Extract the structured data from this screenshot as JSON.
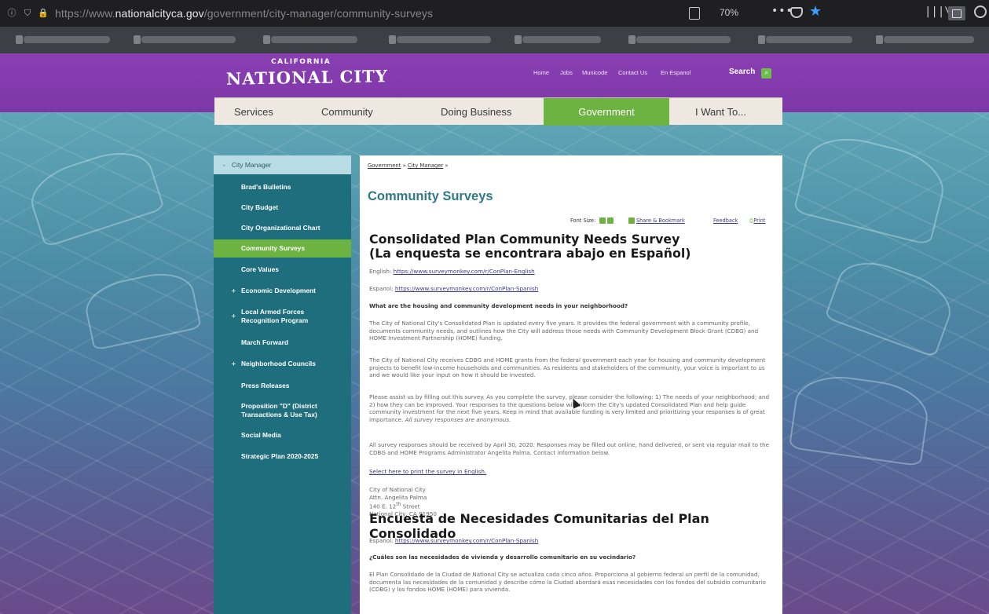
{
  "browser": {
    "url_proto": "https://www.",
    "url_host": "nationalcityca.gov",
    "url_path": "/government/city-manager/community-surveys",
    "zoom": "70%",
    "more": "•••"
  },
  "site": {
    "logo_top": "CALIFORNIA",
    "logo_main": "NATIONAL CITY",
    "util_links": [
      "Home",
      "Jobs",
      "Municode",
      "Contact Us",
      "En Espanol"
    ],
    "search_label": "Search"
  },
  "mainnav": [
    "Services",
    "Community",
    "Doing Business",
    "Government",
    "I Want To..."
  ],
  "sidenav": {
    "top": "City Manager",
    "items": [
      {
        "label": "Brad's Bulletins",
        "plus": false
      },
      {
        "label": "City Budget",
        "plus": false
      },
      {
        "label": "City Organizational Chart",
        "plus": false
      },
      {
        "label": "Community Surveys",
        "plus": false,
        "active": true
      },
      {
        "label": "Core Values",
        "plus": false
      },
      {
        "label": "Economic Development",
        "plus": true
      },
      {
        "label": "Local Armed Forces Recognition Program",
        "plus": true
      },
      {
        "label": "March Forward",
        "plus": false
      },
      {
        "label": "Neighborhood Councils",
        "plus": true
      },
      {
        "label": "Press Releases",
        "plus": false
      },
      {
        "label": "Proposition \"D\" (District Transactions & Use Tax)",
        "plus": false
      },
      {
        "label": "Social Media",
        "plus": false
      },
      {
        "label": "Strategic Plan 2020-2025",
        "plus": false
      }
    ]
  },
  "content": {
    "crumb_gov": "Government",
    "crumb_sep": "»",
    "crumb_cm": "City Manager",
    "page_title": "Community Surveys",
    "font_size": "Font Size:",
    "share": "Share & Bookmark",
    "feedback": "Feedback",
    "print": "Print",
    "heading_en_1": "Consolidated Plan Community Needs Survey",
    "heading_en_2": "(La enquesta se encontrara abajo en Español)",
    "english_label": "English:",
    "english_url": "https://www.surveymonkey.com/r/ConPlan-English",
    "espanol_label": "Espanol:",
    "espanol_url": "https://www.surveymonkey.com/r/ConPlan-Spanish",
    "question": "What are the housing and community development needs in your neighborhood?",
    "para1": "The City of National City's Consolidated Plan is updated every five years. It provides the federal government with a community profile, documents community needs, and outlines how the City will address those needs with Community Development Block Grant (CDBG) and HOME Investment Partnership (HOME) funding.",
    "para2": "The City of National City receives CDBG and HOME grants from the federal government each year for housing and community development projects to benefit low-income households and communities. As residents and stakeholders of the community, your voice is important to us and we would like your input on how it should be invested.",
    "para3": "Please assist us by filling out this survey. As you complete the survey, please consider the following: 1) The needs of your neighborhood; and 2) how they can be improved. Your responses to the questions below will inform the City's updated Consolidated Plan and help guide community investment for the next five years. Keep in mind that available funding is very limited and prioritizing your responses is of great importance.",
    "para3_italic": "All survey responses are anonymous.",
    "para4": "All survey responses should be received by April 30, 2020. Responses may be filled out online, hand delivered, or sent via regular mail to the CDBG and HOME Programs Administrator Angelita Palma. Contact information below.",
    "print_link": "Select here to print the survey in English.",
    "addr1": "City of National City",
    "addr2": "Attn. Angelita Palma",
    "addr3_pre": "140 E. 12",
    "addr3_sup": "th",
    "addr3_post": " Street",
    "addr4": "National City, CA 91950",
    "heading_es": "Encuesta de Necesidades Comunitarias del Plan Consolidado",
    "es_label": "Espanol:",
    "es_url": "https://www.surveymonkey.com/r/ConPlan-Spanish",
    "es_question": "¿Cuáles son las necesidades de vivienda y desarrollo comunitario en su vecindario?",
    "es_para": "El Plan Consolidado de la Ciudad de National City se actualiza cada cinco años. Proporciona al gobierno federal un perfil de la comunidad, documenta las necesidades de la comunidad y describe cómo la Ciudad abordará esas necesidades con los fondos del subsidio comunitario (CDBG) y los fondos HOME (HOME) para vivienda."
  }
}
